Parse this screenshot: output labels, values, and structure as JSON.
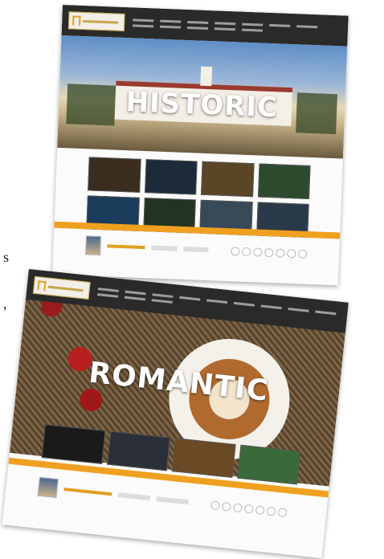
{
  "left_edge": {
    "line1": "s",
    "line2": ","
  },
  "cards": [
    {
      "title": "HISTORIC",
      "thumb_colors": [
        "#3a2d20",
        "#1c2a3a",
        "#5a4626",
        "#2d4a2f",
        "#1b3c5a",
        "#223322",
        "#384a5a",
        "#2a3a4a"
      ]
    },
    {
      "title": "ROMANTIC",
      "thumb_colors": [
        "#1a1a1a",
        "#2a2f3a",
        "#6a4a24",
        "#3a6a3a"
      ]
    }
  ]
}
